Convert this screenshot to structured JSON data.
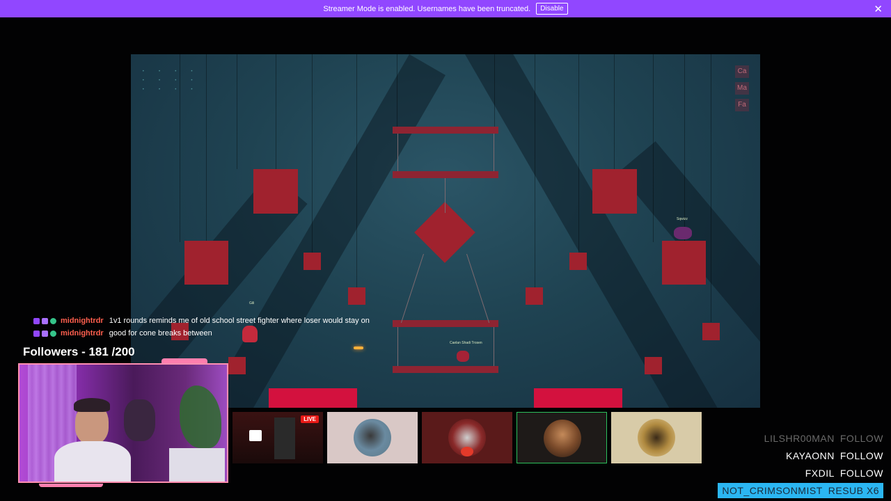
{
  "banner": {
    "message": "Streamer Mode is enabled. Usernames have been truncated.",
    "disable_label": "Disable",
    "color": "#9147ff"
  },
  "game": {
    "hud_dots": "• • • •\n• • • •\n• • • •",
    "tags": [
      "Ca",
      "Ma",
      "Fa"
    ],
    "players": [
      {
        "name": "Gili"
      },
      {
        "name": "Sqwizz"
      },
      {
        "name": "Caelan Shadi Trosen"
      }
    ]
  },
  "chat": {
    "messages": [
      {
        "user": "midnightrdr",
        "text": "1v1 rounds reminds me of old school street fighter where loser would stay on"
      },
      {
        "user": "midnightrdr",
        "text": "good for cone breaks between"
      }
    ]
  },
  "followers": {
    "label": "Followers - 181 /200"
  },
  "stream_row": {
    "live_label": "LIVE"
  },
  "events": [
    {
      "user": "LILSHR00MAN",
      "action": "FOLLOW"
    },
    {
      "user": "KAYAONN",
      "action": "FOLLOW"
    },
    {
      "user": "FXDIL",
      "action": "FOLLOW"
    },
    {
      "user": "NOT_CRIMSONMIST",
      "action": "RESUB X6"
    }
  ],
  "colors": {
    "accent": "#9147ff",
    "highlight": "#2bb6f2",
    "crimson": "#d3113e"
  }
}
